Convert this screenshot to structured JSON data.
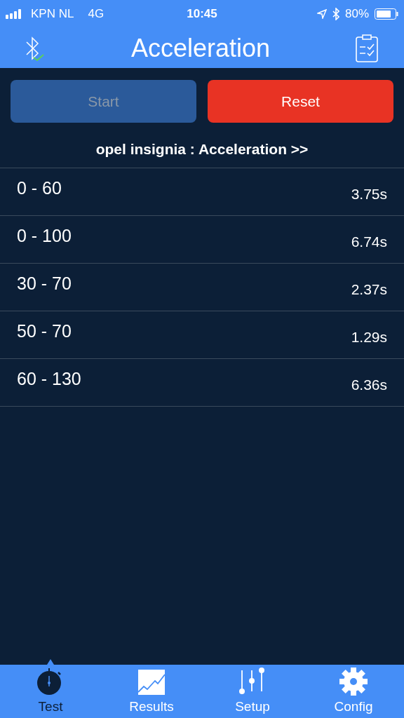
{
  "status_bar": {
    "carrier": "KPN NL",
    "network": "4G",
    "time": "10:45",
    "battery": "80%"
  },
  "nav": {
    "title": "Acceleration"
  },
  "buttons": [
    {
      "label": "Start",
      "kind": "start",
      "disabled": true
    },
    {
      "label": "Reset",
      "kind": "reset",
      "disabled": false
    }
  ],
  "heading": "opel insignia : Acceleration >>",
  "results": [
    {
      "range": "0 - 60",
      "time": "3.75s"
    },
    {
      "range": "0 - 100",
      "time": "6.74s"
    },
    {
      "range": "30 - 70",
      "time": "2.37s"
    },
    {
      "range": "50 - 70",
      "time": "1.29s"
    },
    {
      "range": "60 - 130",
      "time": "6.36s"
    }
  ],
  "tabs": [
    {
      "label": "Test",
      "kind": "stopwatch",
      "selected": true
    },
    {
      "label": "Results",
      "kind": "chart",
      "selected": false
    },
    {
      "label": "Setup",
      "kind": "sliders",
      "selected": false
    },
    {
      "label": "Config",
      "kind": "gear",
      "selected": false
    }
  ]
}
